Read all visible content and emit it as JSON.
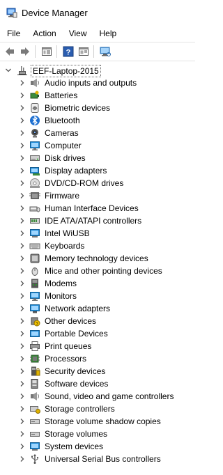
{
  "window": {
    "title": "Device Manager"
  },
  "menu": [
    "File",
    "Action",
    "View",
    "Help"
  ],
  "toolbar": {
    "buttons": [
      "back-arrow-icon",
      "forward-arrow-icon",
      "properties-icon",
      "help-icon",
      "update-driver-icon",
      "monitor-scan-icon"
    ]
  },
  "tree": {
    "root": {
      "label": "EEF-Laptop-2015",
      "expanded": true
    },
    "items": [
      {
        "label": "Audio inputs and outputs",
        "icon": "speaker-icon"
      },
      {
        "label": "Batteries",
        "icon": "battery-icon"
      },
      {
        "label": "Biometric devices",
        "icon": "fingerprint-icon"
      },
      {
        "label": "Bluetooth",
        "icon": "bluetooth-icon"
      },
      {
        "label": "Cameras",
        "icon": "camera-icon"
      },
      {
        "label": "Computer",
        "icon": "computer-icon"
      },
      {
        "label": "Disk drives",
        "icon": "disk-drive-icon"
      },
      {
        "label": "Display adapters",
        "icon": "display-adapter-icon"
      },
      {
        "label": "DVD/CD-ROM drives",
        "icon": "dvd-icon"
      },
      {
        "label": "Firmware",
        "icon": "firmware-icon"
      },
      {
        "label": "Human Interface Devices",
        "icon": "hid-icon"
      },
      {
        "label": "IDE ATA/ATAPI controllers",
        "icon": "ide-controller-icon"
      },
      {
        "label": "Intel WiUSB",
        "icon": "intel-wiusb-icon"
      },
      {
        "label": "Keyboards",
        "icon": "keyboard-icon"
      },
      {
        "label": "Memory technology devices",
        "icon": "memory-icon"
      },
      {
        "label": "Mice and other pointing devices",
        "icon": "mouse-icon"
      },
      {
        "label": "Modems",
        "icon": "modem-icon"
      },
      {
        "label": "Monitors",
        "icon": "monitor-icon"
      },
      {
        "label": "Network adapters",
        "icon": "network-adapter-icon"
      },
      {
        "label": "Other devices",
        "icon": "other-devices-icon"
      },
      {
        "label": "Portable Devices",
        "icon": "portable-device-icon"
      },
      {
        "label": "Print queues",
        "icon": "printer-icon"
      },
      {
        "label": "Processors",
        "icon": "processor-icon"
      },
      {
        "label": "Security devices",
        "icon": "security-icon"
      },
      {
        "label": "Software devices",
        "icon": "software-device-icon"
      },
      {
        "label": "Sound, video and game controllers",
        "icon": "sound-controller-icon"
      },
      {
        "label": "Storage controllers",
        "icon": "storage-controller-icon"
      },
      {
        "label": "Storage volume shadow copies",
        "icon": "shadow-copy-icon"
      },
      {
        "label": "Storage volumes",
        "icon": "storage-volume-icon"
      },
      {
        "label": "System devices",
        "icon": "system-device-icon"
      },
      {
        "label": "Universal Serial Bus controllers",
        "icon": "usb-icon"
      }
    ]
  },
  "colors": {
    "accent": "#1e8ad6",
    "chevron": "#555555"
  }
}
